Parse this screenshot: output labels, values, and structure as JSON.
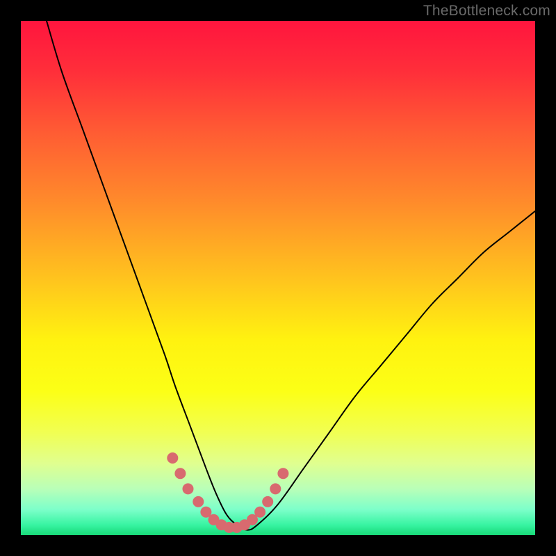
{
  "watermark": "TheBottleneck.com",
  "chart_data": {
    "type": "line",
    "title": "",
    "xlabel": "",
    "ylabel": "",
    "xlim": [
      0,
      100
    ],
    "ylim": [
      0,
      100
    ],
    "grid": false,
    "legend": false,
    "series": [
      {
        "name": "bottleneck-curve",
        "color": "#000000",
        "stroke_width": 2,
        "x": [
          5,
          8,
          12,
          16,
          20,
          24,
          28,
          30,
          33,
          36,
          38,
          40,
          42,
          44,
          46,
          50,
          55,
          60,
          65,
          70,
          75,
          80,
          85,
          90,
          95,
          100
        ],
        "y": [
          100,
          90,
          79,
          68,
          57,
          46,
          35,
          29,
          21,
          13,
          8,
          4,
          2,
          1,
          2,
          6,
          13,
          20,
          27,
          33,
          39,
          45,
          50,
          55,
          59,
          63
        ]
      },
      {
        "name": "highlight-markers",
        "color": "#d86a6f",
        "marker_radius": 8,
        "x": [
          29.5,
          31,
          32.5,
          34.5,
          36,
          37.5,
          39,
          40.5,
          42,
          43.5,
          45,
          46.5,
          48,
          49.5,
          51
        ],
        "y": [
          15,
          12,
          9,
          6.5,
          4.5,
          3,
          2,
          1.5,
          1.5,
          2,
          3,
          4.5,
          6.5,
          9,
          12
        ]
      }
    ],
    "background_gradient": {
      "direction": "vertical",
      "stops": [
        {
          "pos": 0.0,
          "color": "#ff153e"
        },
        {
          "pos": 0.5,
          "color": "#ffc31e"
        },
        {
          "pos": 0.72,
          "color": "#f1ff52"
        },
        {
          "pos": 0.95,
          "color": "#7dffca"
        },
        {
          "pos": 1.0,
          "color": "#18d978"
        }
      ]
    }
  }
}
